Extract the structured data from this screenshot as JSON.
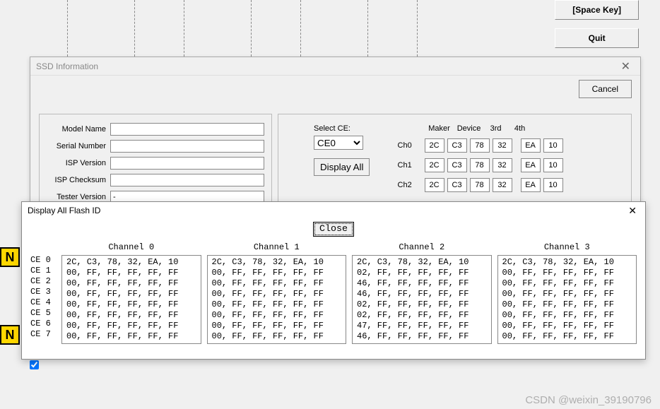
{
  "top": {
    "space_key": "[Space Key]",
    "quit": "Quit"
  },
  "ssd": {
    "title": "SSD Information",
    "cancel": "Cancel",
    "fields": {
      "model_label": "Model Name",
      "model_val": "",
      "serial_label": "Serial Number",
      "serial_val": "",
      "isp_label": "ISP Version",
      "isp_val": "",
      "csum_label": "ISP Checksum",
      "csum_val": "",
      "tester_label": "Tester Version",
      "tester_val": "-"
    },
    "select_ce_label": "Select CE:",
    "select_ce_value": "CE0",
    "display_all": "Display All",
    "hdr": {
      "maker": "Maker",
      "device": "Device",
      "third": "3rd",
      "fourth": "4th"
    },
    "rows": [
      {
        "lbl": "Ch0",
        "v": [
          "2C",
          "C3",
          "78",
          "32",
          "EA",
          "10"
        ]
      },
      {
        "lbl": "Ch1",
        "v": [
          "2C",
          "C3",
          "78",
          "32",
          "EA",
          "10"
        ]
      },
      {
        "lbl": "Ch2",
        "v": [
          "2C",
          "C3",
          "78",
          "32",
          "EA",
          "10"
        ]
      }
    ]
  },
  "flash": {
    "title": "Display All Flash ID",
    "close": "Close",
    "ce_labels": [
      "CE 0",
      "CE 1",
      "CE 2",
      "CE 3",
      "CE 4",
      "CE 5",
      "CE 6",
      "CE 7"
    ],
    "channels": [
      {
        "title": "Channel 0",
        "rows": [
          "2C, C3, 78, 32, EA, 10",
          "00, FF, FF, FF, FF, FF",
          "00, FF, FF, FF, FF, FF",
          "00, FF, FF, FF, FF, FF",
          "00, FF, FF, FF, FF, FF",
          "00, FF, FF, FF, FF, FF",
          "00, FF, FF, FF, FF, FF",
          "00, FF, FF, FF, FF, FF"
        ]
      },
      {
        "title": "Channel 1",
        "rows": [
          "2C, C3, 78, 32, EA, 10",
          "00, FF, FF, FF, FF, FF",
          "00, FF, FF, FF, FF, FF",
          "00, FF, FF, FF, FF, FF",
          "00, FF, FF, FF, FF, FF",
          "00, FF, FF, FF, FF, FF",
          "00, FF, FF, FF, FF, FF",
          "00, FF, FF, FF, FF, FF"
        ]
      },
      {
        "title": "Channel 2",
        "rows": [
          "2C, C3, 78, 32, EA, 10",
          "02, FF, FF, FF, FF, FF",
          "46, FF, FF, FF, FF, FF",
          "46, FF, FF, FF, FF, FF",
          "02, FF, FF, FF, FF, FF",
          "02, FF, FF, FF, FF, FF",
          "47, FF, FF, FF, FF, FF",
          "46, FF, FF, FF, FF, FF"
        ]
      },
      {
        "title": "Channel 3",
        "rows": [
          "2C, C3, 78, 32, EA, 10",
          "00, FF, FF, FF, FF, FF",
          "00, FF, FF, FF, FF, FF",
          "00, FF, FF, FF, FF, FF",
          "00, FF, FF, FF, FF, FF",
          "00, FF, FF, FF, FF, FF",
          "00, FF, FF, FF, FF, FF",
          "00, FF, FF, FF, FF, FF"
        ]
      }
    ]
  },
  "watermark": "CSDN @weixin_39190796"
}
